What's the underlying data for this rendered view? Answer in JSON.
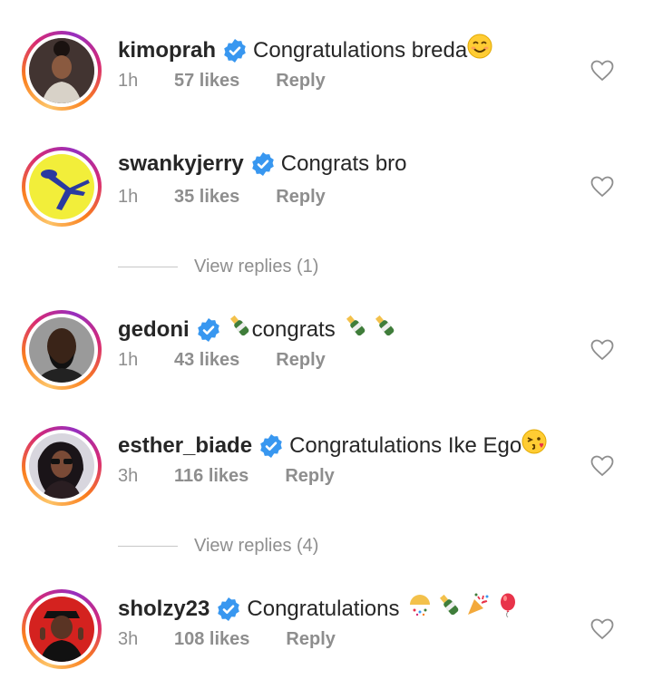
{
  "comments": [
    {
      "username": "kimoprah",
      "text": "Congratulations breda",
      "time": "1h",
      "likes": "57 likes",
      "reply": "Reply",
      "emoji": "smiling-face"
    },
    {
      "username": "swankyjerry",
      "text": "Congrats bro",
      "time": "1h",
      "likes": "35 likes",
      "reply": "Reply"
    },
    {
      "username": "gedoni",
      "text": "congrats",
      "time": "1h",
      "likes": "43 likes",
      "reply": "Reply",
      "emoji": "champagne-bottle"
    },
    {
      "username": "esther_biade",
      "text": "Congratulations Ike Ego",
      "time": "3h",
      "likes": "116 likes",
      "reply": "Reply",
      "emoji": "kissing-face"
    },
    {
      "username": "sholzy23",
      "text": "Congratulations",
      "time": "3h",
      "likes": "108 likes",
      "reply": "Reply",
      "emoji": "party-popper-champagne-balloon"
    }
  ],
  "view_replies": [
    "View replies (1)",
    "View replies (4)"
  ],
  "colors": {
    "verified": "#3897f0",
    "muted": "#8e8e8e",
    "text": "#262626"
  }
}
